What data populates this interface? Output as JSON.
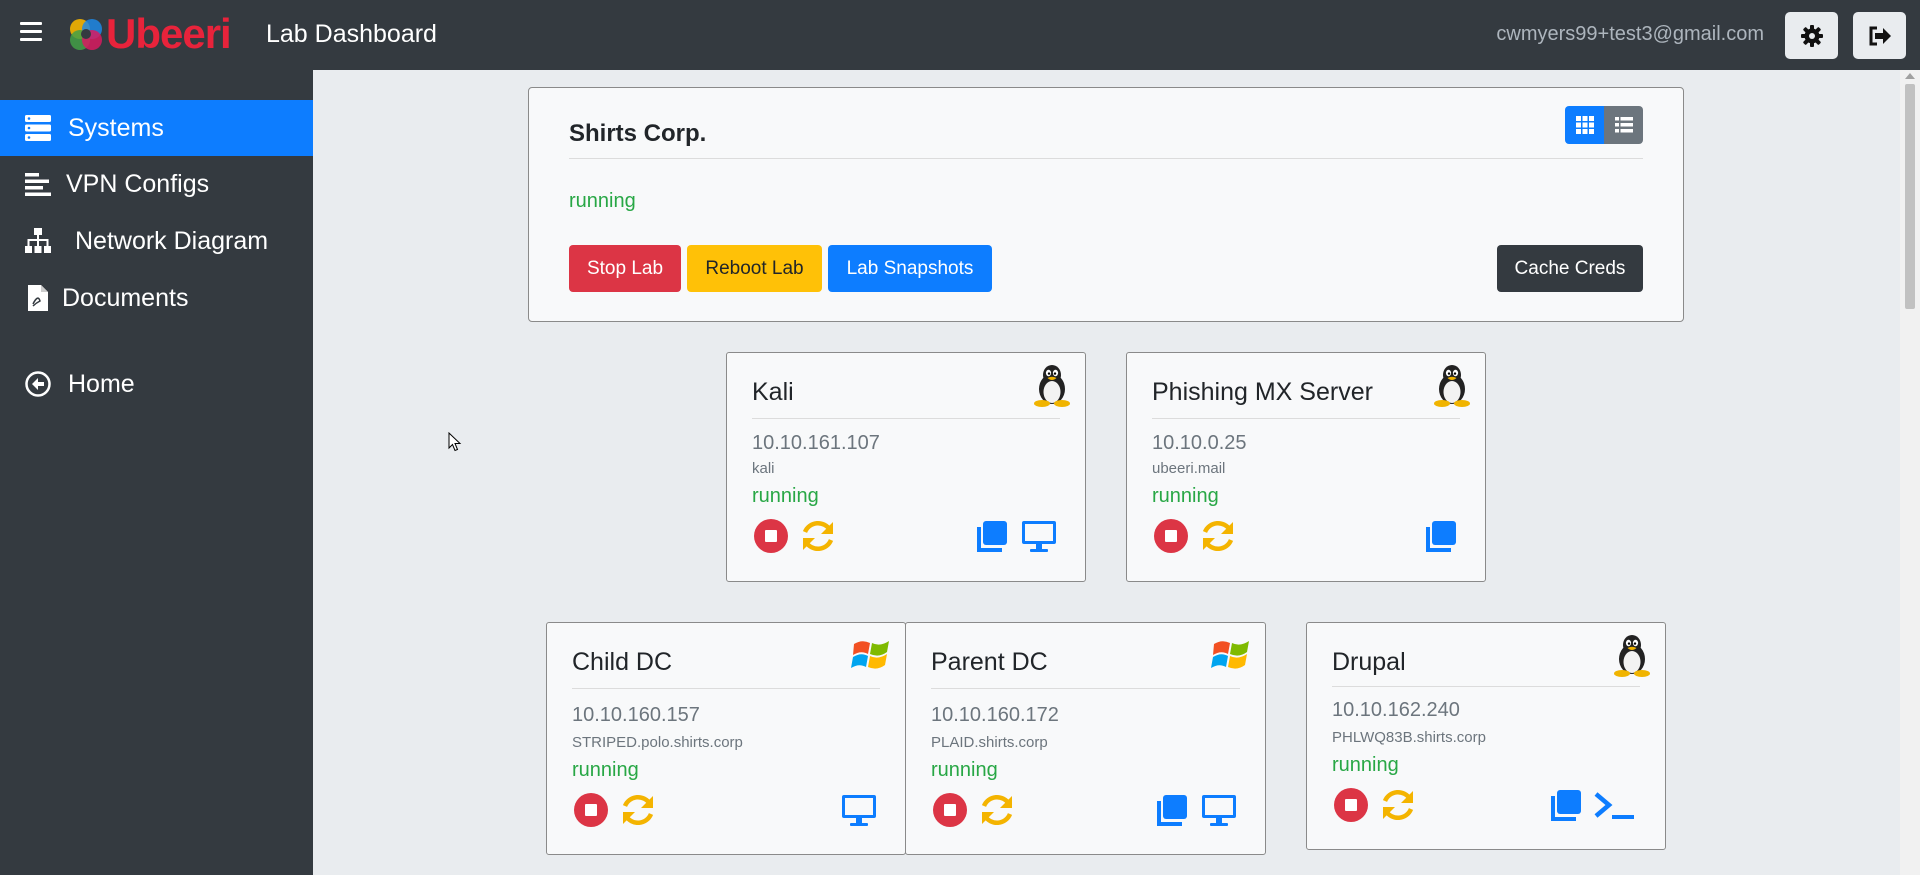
{
  "app": {
    "logo_text": "Ubeeri",
    "page_title": "Lab Dashboard",
    "user_email": "cwmyers99+test3@gmail.com"
  },
  "sidebar": {
    "items": [
      {
        "label": "Systems",
        "icon": "server-icon",
        "active": true
      },
      {
        "label": "VPN Configs",
        "icon": "bars-icon",
        "active": false
      },
      {
        "label": "Network Diagram",
        "icon": "sitemap-icon",
        "active": false
      },
      {
        "label": "Documents",
        "icon": "file-pdf-icon",
        "active": false
      },
      {
        "label": "Home",
        "icon": "arrow-circle-left-icon",
        "active": false
      }
    ]
  },
  "lab": {
    "name": "Shirts Corp.",
    "status": "running",
    "buttons": {
      "stop": "Stop Lab",
      "reboot": "Reboot Lab",
      "snapshots": "Lab Snapshots",
      "cache": "Cache Creds"
    }
  },
  "systems": [
    {
      "title": "Kali",
      "ip": "10.10.161.107",
      "hostname": "kali",
      "status": "running",
      "os": "linux"
    },
    {
      "title": "Phishing MX Server",
      "ip": "10.10.0.25",
      "hostname": "ubeeri.mail",
      "status": "running",
      "os": "linux"
    },
    {
      "title": "Child DC",
      "ip": "10.10.160.157",
      "hostname": "STRIPED.polo.shirts.corp",
      "status": "running",
      "os": "windows"
    },
    {
      "title": "Parent DC",
      "ip": "10.10.160.172",
      "hostname": "PLAID.shirts.corp",
      "status": "running",
      "os": "windows"
    },
    {
      "title": "Drupal",
      "ip": "10.10.162.240",
      "hostname": "PHLWQ83B.shirts.corp",
      "status": "running",
      "os": "linux"
    }
  ],
  "colors": {
    "primary": "#0d7dff",
    "danger": "#dc3545",
    "warning": "#ffc107",
    "success": "#28a745",
    "dark": "#343a40",
    "brand": "#e8233b"
  }
}
